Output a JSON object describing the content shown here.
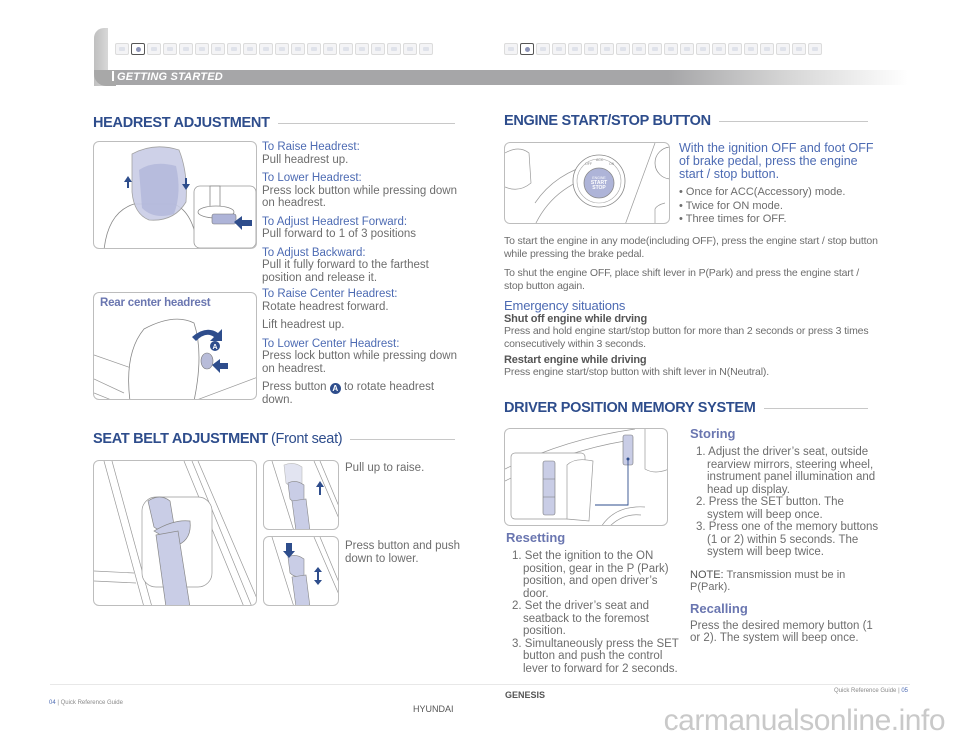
{
  "header": {
    "section_label": "GETTING STARTED",
    "left_strip_icons": [
      "engine-icon",
      "airbag-icon",
      "steering-icon",
      "key-icon",
      "door-icon",
      "seat-icon",
      "mirror-icon",
      "window-icon",
      "wiper-icon",
      "light-icon",
      "climate-icon",
      "audio-icon",
      "phone-icon",
      "camera-icon",
      "sunroof-icon",
      "trunk-icon",
      "auto-hold-icon",
      "seatbelt-icon",
      "fuel-icon",
      "parking-icon"
    ],
    "left_active_index": 1,
    "right_strip_icons": [
      "pen-icon",
      "start-button-icon",
      "phone-icon",
      "wiper-icon",
      "cruise-icon",
      "menu-icon",
      "display-icon",
      "car-icon",
      "lane-icon",
      "bluetooth-icon",
      "voice-icon",
      "lamp-icon",
      "tire-icon",
      "sensor-icon",
      "road-icon",
      "brake-icon",
      "tpms-icon",
      "vehicle-icon",
      "hazard-icon",
      "memo-icon"
    ],
    "right_active_index": 1
  },
  "headrest": {
    "title": "HEADREST ADJUSTMENT",
    "items": [
      {
        "heading": "To Raise Headrest:",
        "body": "Pull headrest up."
      },
      {
        "heading": "To Lower Headrest:",
        "body": "Press lock button while pressing down on headrest."
      },
      {
        "heading": "To Adjust Headrest Forward:",
        "body": "Pull forward to 1 of 3 positions"
      },
      {
        "heading": "To Adjust Backward:",
        "body": "Pull it fully forward to the farthest position and release it."
      },
      {
        "heading": "To Raise Center Headrest:",
        "body": "Rotate headrest forward."
      },
      {
        "heading": "",
        "body": "Lift headrest up."
      },
      {
        "heading": "To Lower Center Headrest:",
        "body": "Press lock button while pressing down on headrest."
      }
    ],
    "press_button_prefix": "Press button",
    "badge_letter": "A",
    "press_button_suffix": "to rotate headrest down.",
    "rear_label": "Rear center headrest"
  },
  "seatbelt": {
    "title": "SEAT BELT ADJUSTMENT",
    "subtitle": "(Front seat)",
    "raise_text": "Pull up to raise.",
    "lower_text": "Press button and push down to lower."
  },
  "engine": {
    "title": "ENGINE START/STOP BUTTON",
    "lead": "With the ignition OFF and foot OFF of brake pedal, press the engine start / stop button.",
    "bullets": [
      "Once for ACC(Accessory) mode.",
      "Twice for ON mode.",
      "Three times for OFF."
    ],
    "button_label": "ENGINE START STOP",
    "ring_labels": [
      "OFF",
      "ACC",
      "ON"
    ],
    "para1": "To start the engine in any mode(including OFF), press the engine start / stop button while pressing the brake pedal.",
    "para2": "To shut the engine OFF, place shift lever in P(Park) and press the engine start / stop button again.",
    "emergency_heading": "Emergency situations",
    "shutoff_heading": "Shut off engine while drving",
    "shutoff_body": "Press and hold engine start/stop button for more than 2 seconds or press 3 times consecutively within 3 seconds.",
    "restart_heading": "Restart engine while driving",
    "restart_body": "Press engine start/stop button with shift lever in N(Neutral)."
  },
  "memory": {
    "title": "DRIVER POSITION MEMORY SYSTEM",
    "storing_heading": "Storing",
    "storing_steps": [
      {
        "num": "1.",
        "text": "Adjust the driver’s seat, outside rearview mirrors, steering wheel, instrument panel illumination and head up display."
      },
      {
        "num": "2.",
        "text": "Press the SET button. The system will beep once."
      },
      {
        "num": "3.",
        "text": "Press one of the memory buttons (1 or 2) within 5 seconds. The system will beep twice."
      }
    ],
    "note_label": "NOTE:",
    "note_text": "Transmission must be in P(Park).",
    "recalling_heading": "Recalling",
    "recalling_text": "Press the desired memory button (1 or 2). The system will beep once.",
    "resetting_heading": "Resetting",
    "resetting_steps": [
      {
        "num": "1.",
        "text": "Set the ignition to the ON position, gear in the P (Park) position, and open driver’s door."
      },
      {
        "num": "2.",
        "text": "Set the driver’s seat and seatback to the foremost position."
      },
      {
        "num": "3.",
        "text": "Simultaneously press the SET button and push the control lever to forward for 2 seconds."
      }
    ]
  },
  "footer": {
    "left_page": "04",
    "left_text": "Quick Reference Guide",
    "right_text": "Quick Reference Guide",
    "right_page": "05",
    "brand": "GENESIS",
    "maker": "HYUNDAI",
    "watermark": "carmanualsonline.info"
  },
  "colors": {
    "heading_blue": "#2e4d8c",
    "subheading_blue": "#4d6bb3",
    "illustration_fill": "#c9cde6",
    "body_gray": "#6d6d6d"
  }
}
